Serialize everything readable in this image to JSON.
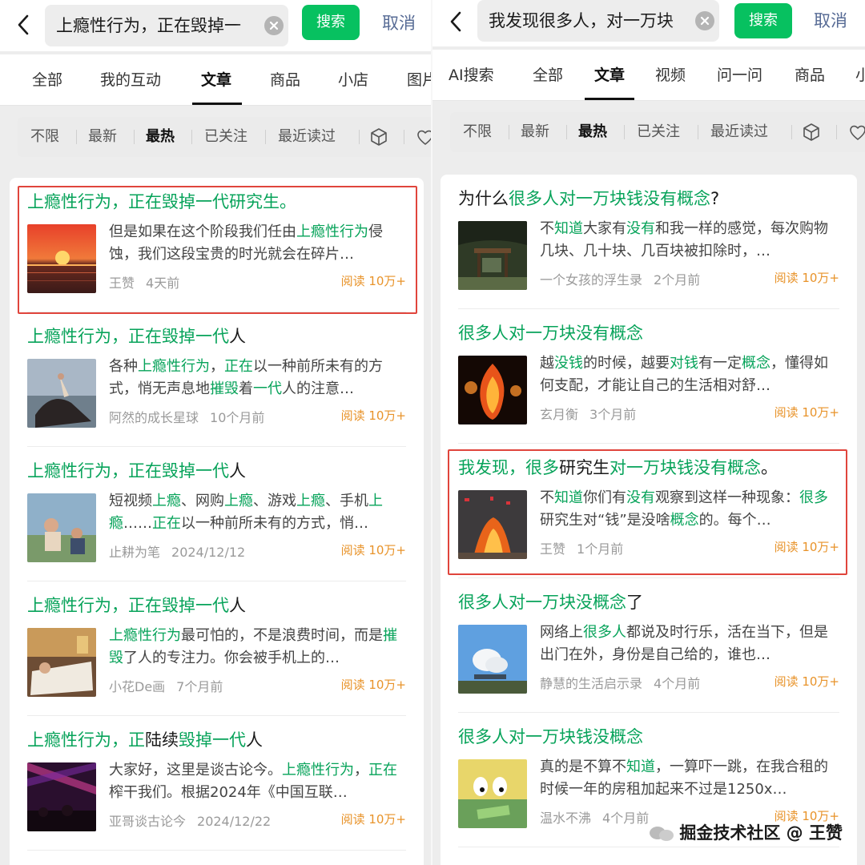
{
  "left": {
    "query": "上瘾性行为，正在毁掉一",
    "search_label": "搜索",
    "cancel_label": "取消",
    "tabs": [
      "全部",
      "我的互动",
      "文章",
      "商品",
      "小店",
      "图片"
    ],
    "filters": [
      "不限",
      "最新",
      "最热",
      "已关注",
      "最近读过"
    ],
    "items": [
      {
        "title_parts": [
          {
            "t": "上瘾性行为，正在毁掉一代研究生。",
            "hl": true
          }
        ],
        "snippet_parts": [
          {
            "t": "但是如果在这个阶段我们任由",
            "hl": false
          },
          {
            "t": "上瘾性行为",
            "hl": true
          },
          {
            "t": "侵蚀，我们这段宝贵的时光就会在碎片…",
            "hl": false
          }
        ],
        "author": "王赞",
        "time": "4天前",
        "reads": "阅读 10万+",
        "thumb": "sunset"
      },
      {
        "title_parts": [
          {
            "t": "上瘾性行为，正在毁掉一代",
            "hl": true
          },
          {
            "t": "人",
            "hl": false
          }
        ],
        "snippet_parts": [
          {
            "t": "各种",
            "hl": false
          },
          {
            "t": "上瘾性行为",
            "hl": true
          },
          {
            "t": "，",
            "hl": false
          },
          {
            "t": "正在",
            "hl": true
          },
          {
            "t": "以一种前所未有的方式，悄无声息地",
            "hl": false
          },
          {
            "t": "摧毁",
            "hl": true
          },
          {
            "t": "着",
            "hl": false
          },
          {
            "t": "一代",
            "hl": true
          },
          {
            "t": "人的注意…",
            "hl": false
          }
        ],
        "author": "阿然的成长星球",
        "time": "10个月前",
        "reads": "阅读 10万+",
        "thumb": "painting"
      },
      {
        "title_parts": [
          {
            "t": "上瘾性行为，正在毁掉一代",
            "hl": true
          },
          {
            "t": "人",
            "hl": false
          }
        ],
        "snippet_parts": [
          {
            "t": "短视频",
            "hl": false
          },
          {
            "t": "上瘾",
            "hl": true
          },
          {
            "t": "、网购",
            "hl": false
          },
          {
            "t": "上瘾",
            "hl": true
          },
          {
            "t": "、游戏",
            "hl": false
          },
          {
            "t": "上瘾",
            "hl": true
          },
          {
            "t": "、手机",
            "hl": false
          },
          {
            "t": "上瘾",
            "hl": true
          },
          {
            "t": "……",
            "hl": false
          },
          {
            "t": "正在",
            "hl": true
          },
          {
            "t": "以一种前所未有的方式，悄…",
            "hl": false
          }
        ],
        "author": "止耕为笔",
        "time": "2024/12/12",
        "reads": "阅读 10万+",
        "thumb": "bathers"
      },
      {
        "title_parts": [
          {
            "t": "上瘾性行为，正在毁掉一代",
            "hl": true
          },
          {
            "t": "人",
            "hl": false
          }
        ],
        "snippet_parts": [
          {
            "t": "上瘾性行为",
            "hl": true
          },
          {
            "t": "最可怕的，不是浪费时间，而是",
            "hl": false
          },
          {
            "t": "摧毁",
            "hl": true
          },
          {
            "t": "了人的专注力。你会被手机上的…",
            "hl": false
          }
        ],
        "author": "小花De画",
        "time": "7个月前",
        "reads": "阅读 10万+",
        "thumb": "bed"
      },
      {
        "title_parts": [
          {
            "t": "上瘾性行为，正",
            "hl": true
          },
          {
            "t": "陆续",
            "hl": false
          },
          {
            "t": "毁掉一代",
            "hl": true
          },
          {
            "t": "人",
            "hl": false
          }
        ],
        "snippet_parts": [
          {
            "t": "大家好，这里是谈古论今。",
            "hl": false
          },
          {
            "t": "上瘾性行为",
            "hl": true
          },
          {
            "t": "，",
            "hl": false
          },
          {
            "t": "正在",
            "hl": true
          },
          {
            "t": "榨干我们。根据2024年《中国互联…",
            "hl": false
          }
        ],
        "author": "亚哥谈古论今",
        "time": "2024/12/22",
        "reads": "阅读 10万+",
        "thumb": "concert"
      }
    ]
  },
  "right": {
    "query": "我发现很多人，对一万块",
    "search_label": "搜索",
    "cancel_label": "取消",
    "tabs": [
      "AI搜索",
      "全部",
      "文章",
      "视频",
      "问一问",
      "商品",
      "小"
    ],
    "filters": [
      "不限",
      "最新",
      "最热",
      "已关注",
      "最近读过"
    ],
    "items": [
      {
        "title_parts": [
          {
            "t": "为什么",
            "hl": false
          },
          {
            "t": "很多人对一万块钱没有概念",
            "hl": true
          },
          {
            "t": "?",
            "hl": false
          }
        ],
        "snippet_parts": [
          {
            "t": "不",
            "hl": false
          },
          {
            "t": "知道",
            "hl": true
          },
          {
            "t": "大家有",
            "hl": false
          },
          {
            "t": "没有",
            "hl": true
          },
          {
            "t": "和我一样的感觉，每次购物几块、几十块、几百块被扣除时，…",
            "hl": false
          }
        ],
        "author": "一个女孩的浮生录",
        "time": "2个月前",
        "reads": "阅读 10万+",
        "thumb": "pavilion"
      },
      {
        "title_parts": [
          {
            "t": "很多人对一万块没有概念",
            "hl": true
          }
        ],
        "snippet_parts": [
          {
            "t": "越",
            "hl": false
          },
          {
            "t": "没钱",
            "hl": true
          },
          {
            "t": "的时候，越要",
            "hl": false
          },
          {
            "t": "对钱",
            "hl": true
          },
          {
            "t": "有一定",
            "hl": false
          },
          {
            "t": "概念",
            "hl": true
          },
          {
            "t": "，懂得如何支配，才能让自己的生活相对舒…",
            "hl": false
          }
        ],
        "author": "玄月衡",
        "time": "3个月前",
        "reads": "阅读 10万+",
        "thumb": "fire"
      },
      {
        "title_parts": [
          {
            "t": "我发现，很多",
            "hl": true
          },
          {
            "t": "研究生",
            "hl": false
          },
          {
            "t": "对一万块钱没有概念",
            "hl": true
          },
          {
            "t": "。",
            "hl": false
          }
        ],
        "snippet_parts": [
          {
            "t": "不",
            "hl": false
          },
          {
            "t": "知道",
            "hl": true
          },
          {
            "t": "你们有",
            "hl": false
          },
          {
            "t": "没有",
            "hl": true
          },
          {
            "t": "观察到这样一种现象：",
            "hl": false
          },
          {
            "t": "很多",
            "hl": true
          },
          {
            "t": "研究生对“钱”是没啥",
            "hl": false
          },
          {
            "t": "概念",
            "hl": true
          },
          {
            "t": "的。每个…",
            "hl": false
          }
        ],
        "author": "王赞",
        "time": "1个月前",
        "reads": "阅读 10万+",
        "thumb": "burning"
      },
      {
        "title_parts": [
          {
            "t": "很多人对一万块没概念",
            "hl": true
          },
          {
            "t": "了",
            "hl": false
          }
        ],
        "snippet_parts": [
          {
            "t": "网络上",
            "hl": false
          },
          {
            "t": "很多人",
            "hl": true
          },
          {
            "t": "都说及时行乐，活在当下，但是出门在外，身份是自己给的，谁也…",
            "hl": false
          }
        ],
        "author": "静慧的生活启示录",
        "time": "4个月前",
        "reads": "阅读 10万+",
        "thumb": "sky"
      },
      {
        "title_parts": [
          {
            "t": "很多人对一万块钱没概念",
            "hl": true
          }
        ],
        "snippet_parts": [
          {
            "t": "真的是不算不",
            "hl": false
          },
          {
            "t": "知道",
            "hl": true
          },
          {
            "t": "，一算吓一跳，在我合租的时候一年的房租加起来不过是1250x…",
            "hl": false
          }
        ],
        "author": "温水不沸",
        "time": "4个月前",
        "reads": "阅读 10万+",
        "thumb": "cartoon"
      }
    ]
  },
  "watermark": "掘金技术社区 @ 王赞",
  "colors": {
    "accent": "#07c160",
    "highlight_text": "#07a35a",
    "reads": "#e8932a",
    "cancel": "#576b95",
    "box": "#e0453c"
  }
}
